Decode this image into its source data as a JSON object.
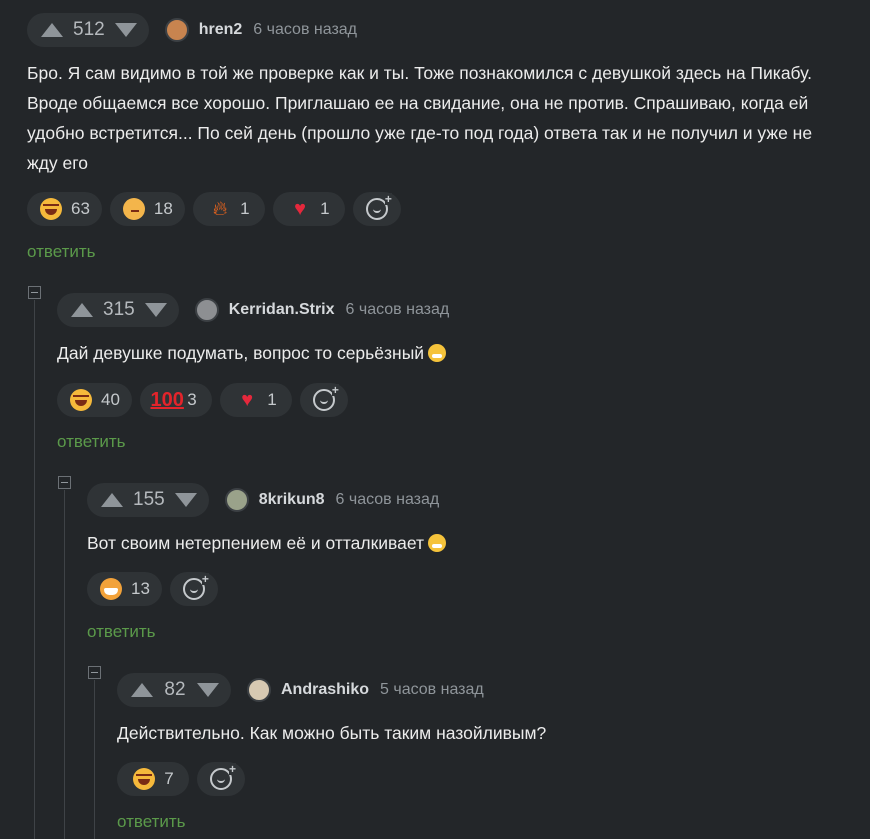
{
  "comments": [
    {
      "score": "512",
      "user": "hren2",
      "time": "6 часов назад",
      "text": "Бро. Я сам видимо в той же проверке как и ты. Тоже познакомился с девушкой здесь на Пикабу. Вроде общаемся все хорошо. Приглашаю ее на свидание, она не против. Спрашиваю, когда ей удобно встретится... По сей день (прошло уже где-то под года) ответа так и не получил и уже не жду его",
      "reactions": [
        {
          "icon": "laughing-face-icon",
          "count": "63"
        },
        {
          "icon": "thinking-face-icon",
          "count": "18"
        },
        {
          "icon": "fire-icon",
          "count": "1"
        },
        {
          "icon": "heart-icon",
          "count": "1"
        }
      ],
      "reply": "ответить",
      "avatar_color": "#c8844f"
    },
    {
      "score": "315",
      "user": "Kerridan.Strix",
      "time": "6 часов назад",
      "text": "Дай девушке подумать, вопрос то серьёзный",
      "reactions": [
        {
          "icon": "laughing-face-icon",
          "count": "40"
        },
        {
          "icon": "hundred-icon",
          "count": "3"
        },
        {
          "icon": "heart-icon",
          "count": "1"
        }
      ],
      "reply": "ответить",
      "avatar_color": "#8d8f92"
    },
    {
      "score": "155",
      "user": "8krikun8",
      "time": "6 часов назад",
      "text": "Вот своим нетерпением её и отталкивает",
      "reactions": [
        {
          "icon": "grinning-face-icon",
          "count": "13"
        }
      ],
      "reply": "ответить",
      "avatar_color": "#9aa28a"
    },
    {
      "score": "82",
      "user": "Andrashiko",
      "time": "5 часов назад",
      "text": "Действительно. Как можно быть таким назойливым?",
      "reactions": [
        {
          "icon": "laughing-face-icon",
          "count": "7"
        }
      ],
      "reply": "ответить",
      "avatar_color": "#d7c9b2"
    }
  ],
  "colors": {
    "background": "#232629",
    "pill": "#2f3336",
    "reply_link": "#5b9a4a",
    "muted": "#8f959a"
  }
}
